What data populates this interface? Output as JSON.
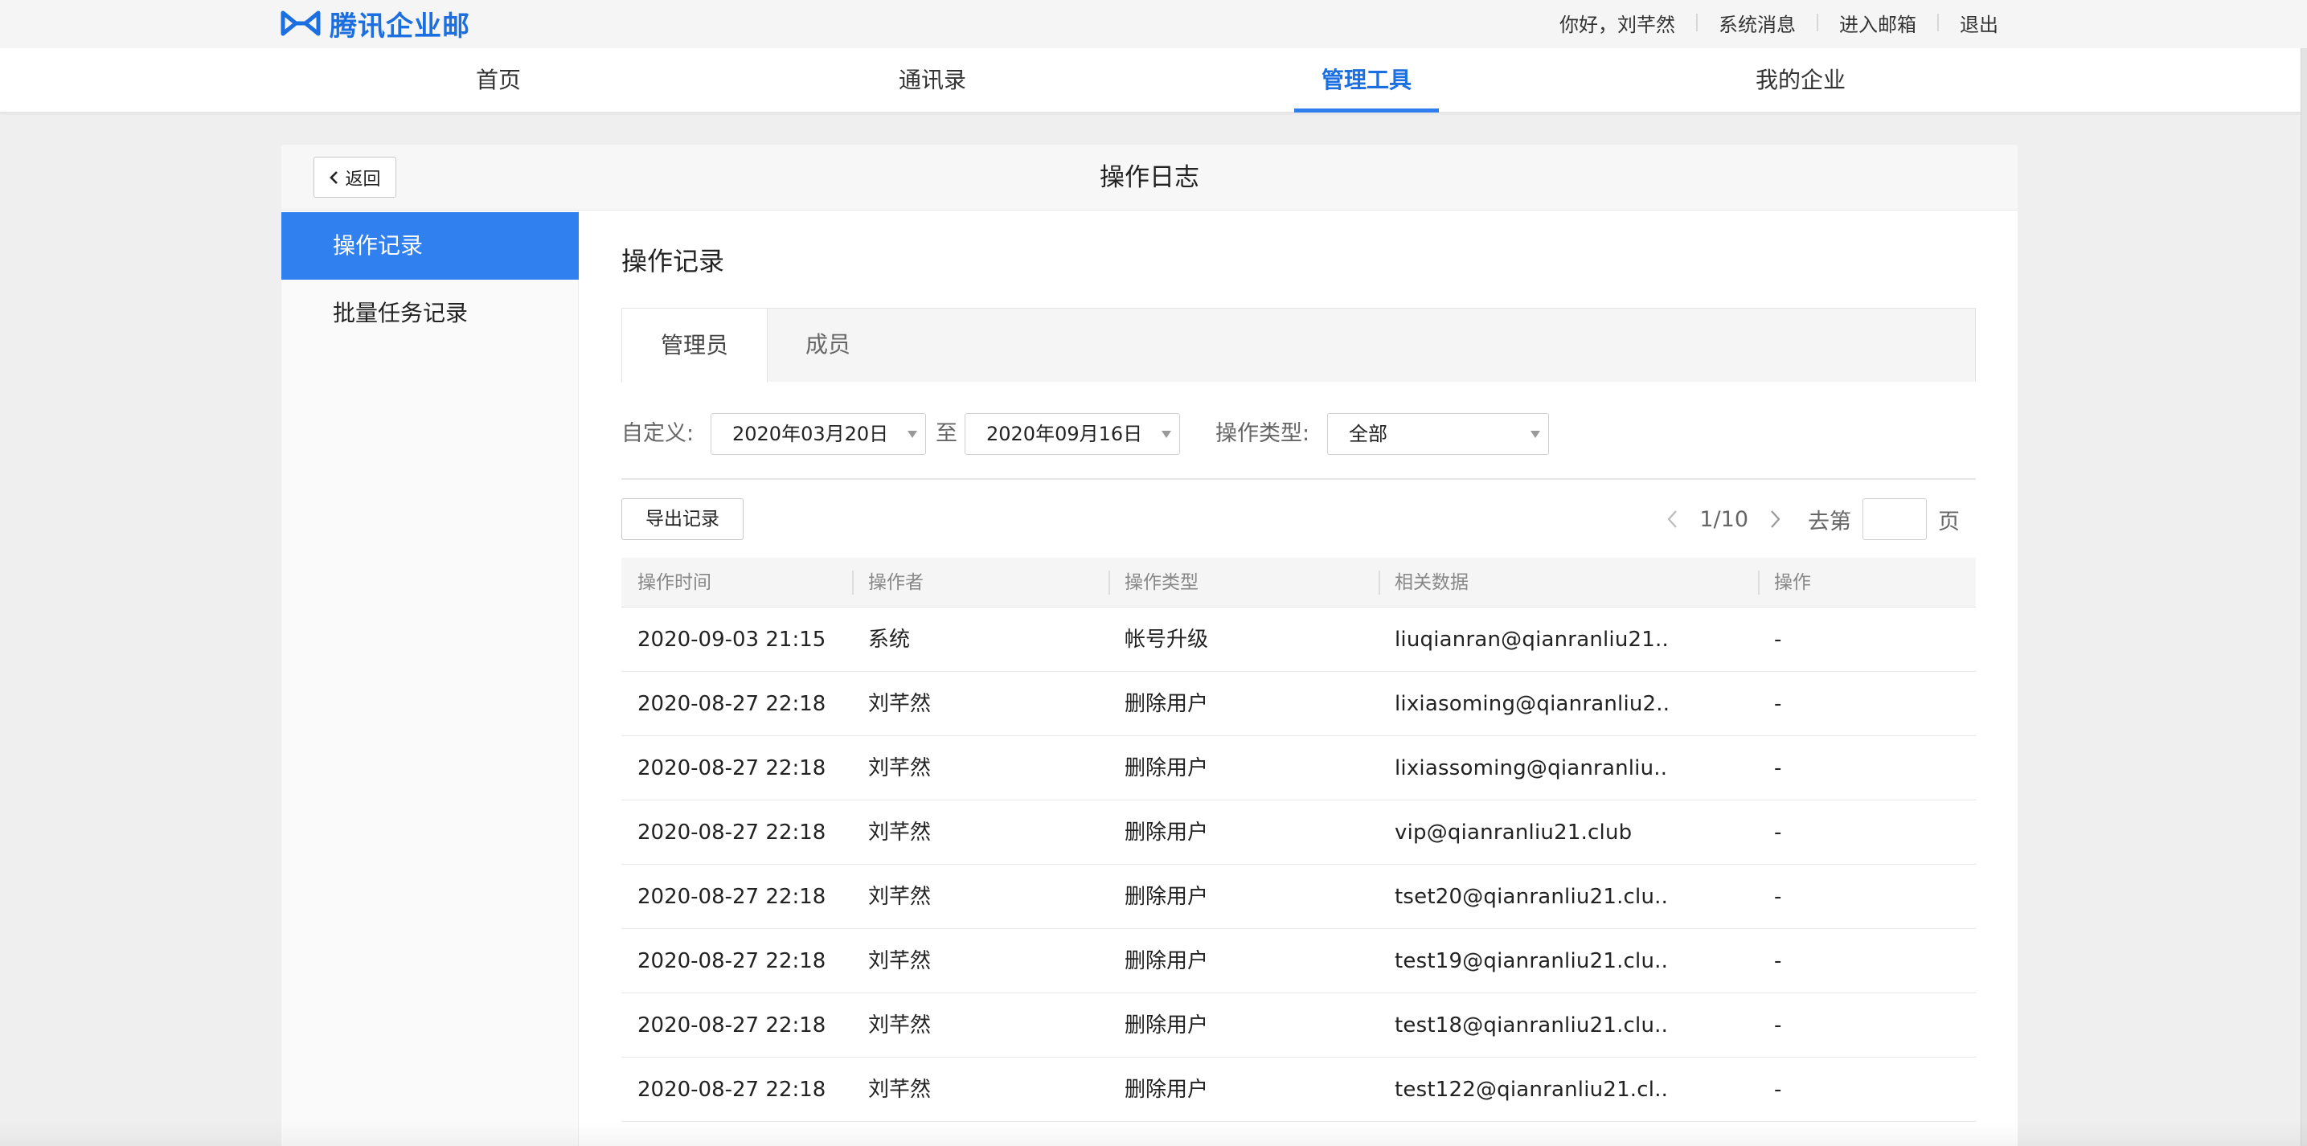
{
  "brand": {
    "name": "腾讯企业邮",
    "color": "#1c6fe1",
    "icon": "tencent-exmail-logo"
  },
  "top_links": {
    "greeting": "你好，刘芊然",
    "messages": "系统消息",
    "mailbox": "进入邮箱",
    "logout": "退出"
  },
  "nav": {
    "home": "首页",
    "contacts": "通讯录",
    "admin_tools": "管理工具",
    "my_company": "我的企业",
    "active": "管理工具"
  },
  "panel": {
    "back_label": "返回",
    "title": "操作日志"
  },
  "sidebar": {
    "items": [
      {
        "label": "操作记录",
        "active": true
      },
      {
        "label": "批量任务记录",
        "active": false
      }
    ]
  },
  "content": {
    "title": "操作记录",
    "tabs": [
      {
        "label": "管理员",
        "active": true
      },
      {
        "label": "成员",
        "active": false
      }
    ]
  },
  "filters": {
    "custom_label": "自定义:",
    "start_date": "2020年03月20日",
    "to_label": "至",
    "end_date": "2020年09月16日",
    "type_label": "操作类型:",
    "type_value": "全部"
  },
  "toolbar": {
    "export_label": "导出记录"
  },
  "pager": {
    "page_text": "1/10",
    "goto_label": "去第",
    "page_suffix": "页"
  },
  "table": {
    "headers": {
      "time": "操作时间",
      "operator": "操作者",
      "type": "操作类型",
      "data": "相关数据",
      "action": "操作"
    },
    "rows": [
      {
        "time": "2020-09-03 21:15",
        "operator": "系统",
        "type": "帐号升级",
        "data": "liuqianran@qianranliu21..",
        "action": "-"
      },
      {
        "time": "2020-08-27 22:18",
        "operator": "刘芊然",
        "type": "删除用户",
        "data": "lixiasoming@qianranliu2..",
        "action": "-"
      },
      {
        "time": "2020-08-27 22:18",
        "operator": "刘芊然",
        "type": "删除用户",
        "data": "lixiassoming@qianranliu..",
        "action": "-"
      },
      {
        "time": "2020-08-27 22:18",
        "operator": "刘芊然",
        "type": "删除用户",
        "data": "vip@qianranliu21.club",
        "action": "-"
      },
      {
        "time": "2020-08-27 22:18",
        "operator": "刘芊然",
        "type": "删除用户",
        "data": "tset20@qianranliu21.clu..",
        "action": "-"
      },
      {
        "time": "2020-08-27 22:18",
        "operator": "刘芊然",
        "type": "删除用户",
        "data": "test19@qianranliu21.clu..",
        "action": "-"
      },
      {
        "time": "2020-08-27 22:18",
        "operator": "刘芊然",
        "type": "删除用户",
        "data": "test18@qianranliu21.clu..",
        "action": "-"
      },
      {
        "time": "2020-08-27 22:18",
        "operator": "刘芊然",
        "type": "删除用户",
        "data": "test122@qianranliu21.cl..",
        "action": "-"
      }
    ]
  },
  "colors": {
    "accent": "#3180f0",
    "nav_active": "#1c6fe1",
    "background": "#efefef"
  }
}
